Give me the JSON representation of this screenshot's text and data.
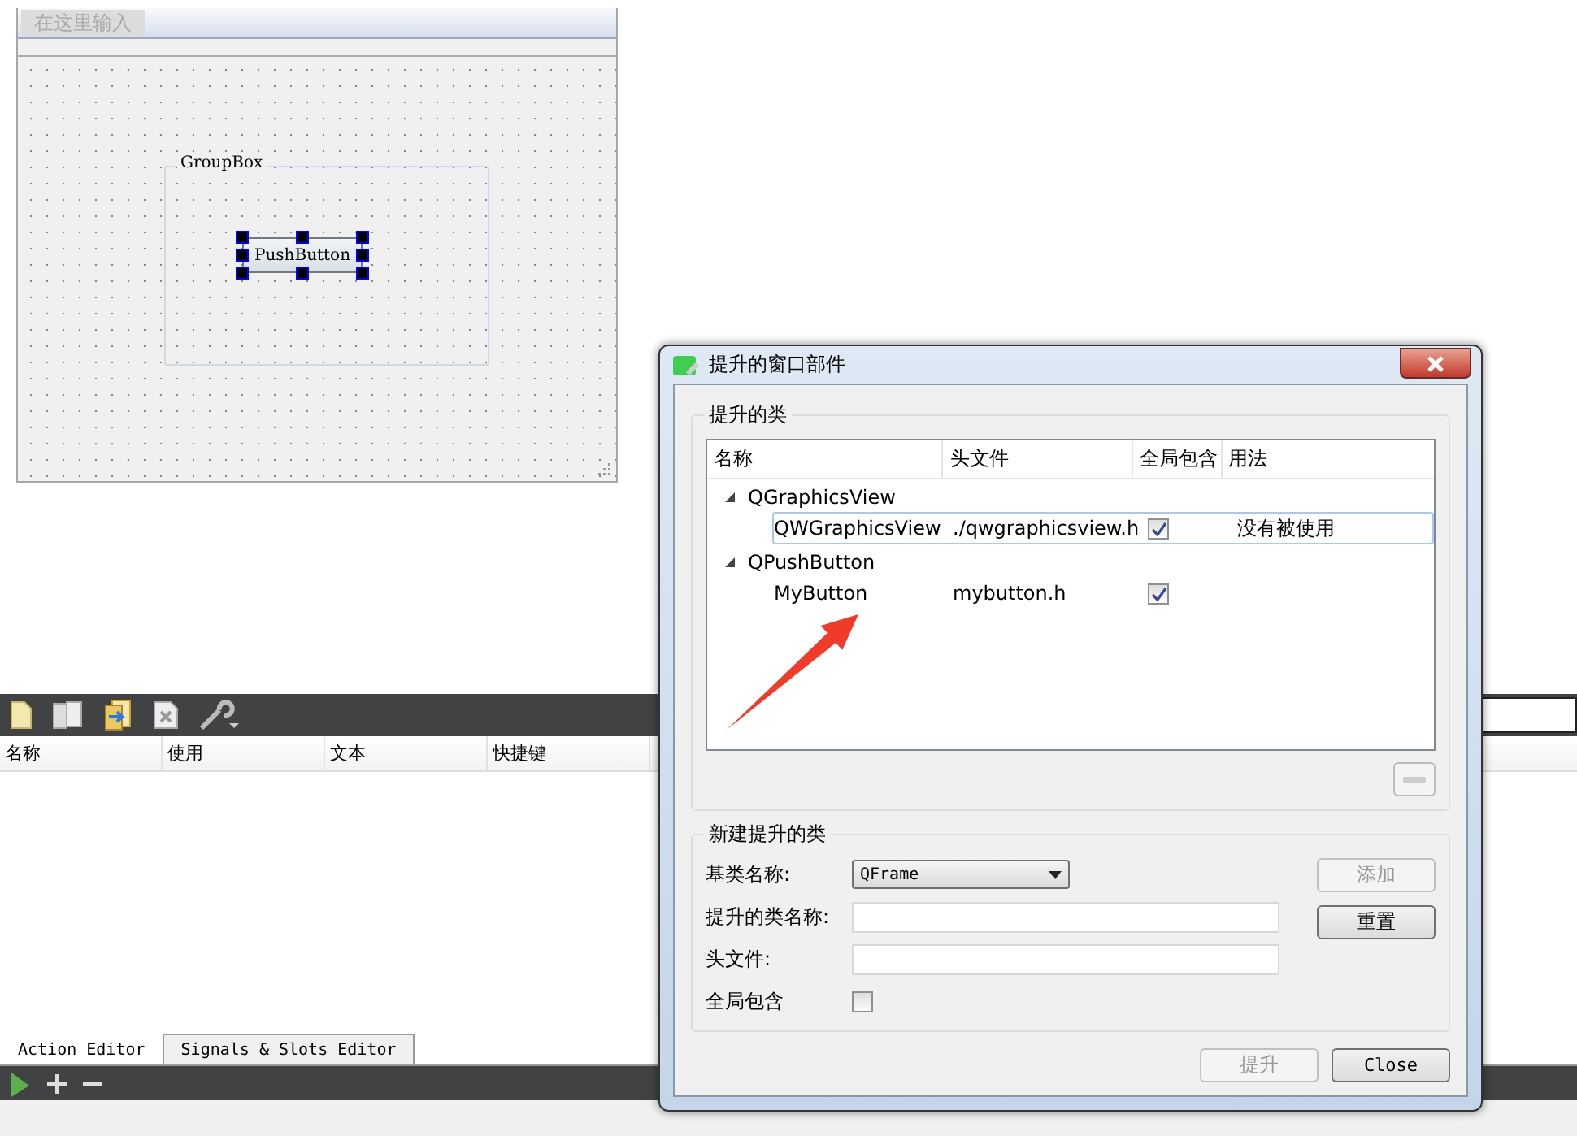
{
  "designer_form": {
    "menu_placeholder": "在这里输入",
    "group_box": {
      "title": "GroupBox",
      "button": {
        "label": "PushButton",
        "selected": true
      }
    }
  },
  "action_editor": {
    "columns": [
      "名称",
      "使用",
      "文本",
      "快捷键"
    ],
    "tabs": [
      {
        "label": "Action Editor",
        "selected": true
      },
      {
        "label": "Signals & Slots Editor",
        "selected": false
      }
    ]
  },
  "dialog": {
    "title": "提升的窗口部件",
    "promoted": {
      "title": "提升的类",
      "columns": [
        "名称",
        "头文件",
        "全局包含",
        "用法"
      ],
      "groups": [
        {
          "name": "QGraphicsView",
          "expanded": true,
          "children": [
            {
              "name": "QWGraphicsView",
              "header": "./qwgraphicsview.h",
              "global_include": true,
              "usage": "没有被使用",
              "selected": true
            }
          ]
        },
        {
          "name": "QPushButton",
          "expanded": true,
          "children": [
            {
              "name": "MyButton",
              "header": "mybutton.h",
              "global_include": true,
              "selected": false
            }
          ]
        }
      ]
    },
    "new_promoted": {
      "title": "新建提升的类",
      "base_class_label": "基类名称:",
      "base_class": "QFrame",
      "class_name_label": "提升的类名称:",
      "header_label": "头文件:",
      "global_include_label": "全局包含",
      "global_include": false,
      "buttons": [
        {
          "label": "添加",
          "disabled": true
        },
        {
          "label": "重置",
          "disabled": false
        }
      ]
    },
    "buttons": [
      {
        "label": "提升",
        "disabled": true
      },
      {
        "label": "Close",
        "disabled": false
      }
    ]
  }
}
